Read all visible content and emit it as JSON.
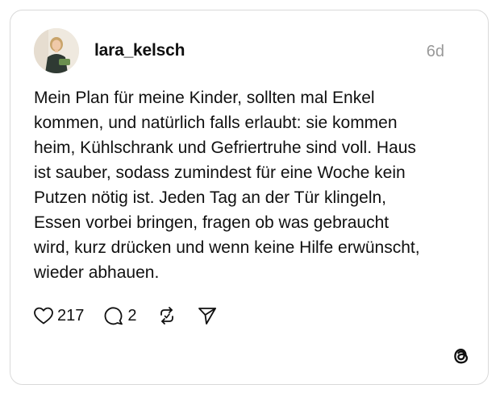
{
  "post": {
    "username": "lara_kelsch",
    "time": "6d",
    "text": "Mein Plan für meine Kinder, sollten mal Enkel\nkommen, und natürlich falls erlaubt: sie kommen\nheim, Kühlschrank und Gefriertruhe sind voll. Haus\nist sauber, sodass zumindest für eine Woche kein\nPutzen nötig ist. Jeden Tag an der Tür klingeln,\nEssen vorbei bringen, fragen ob was gebraucht\nwird, kurz drücken und wenn keine Hilfe erwünscht,\nwieder abhauen.",
    "likes": "217",
    "replies": "2"
  },
  "icons": {
    "like": "heart-icon",
    "reply": "comment-icon",
    "repost": "repost-icon",
    "share": "send-icon",
    "brand": "threads-logo-icon"
  },
  "colors": {
    "text": "#101010",
    "muted": "#999999",
    "border": "#d9d9d9"
  }
}
